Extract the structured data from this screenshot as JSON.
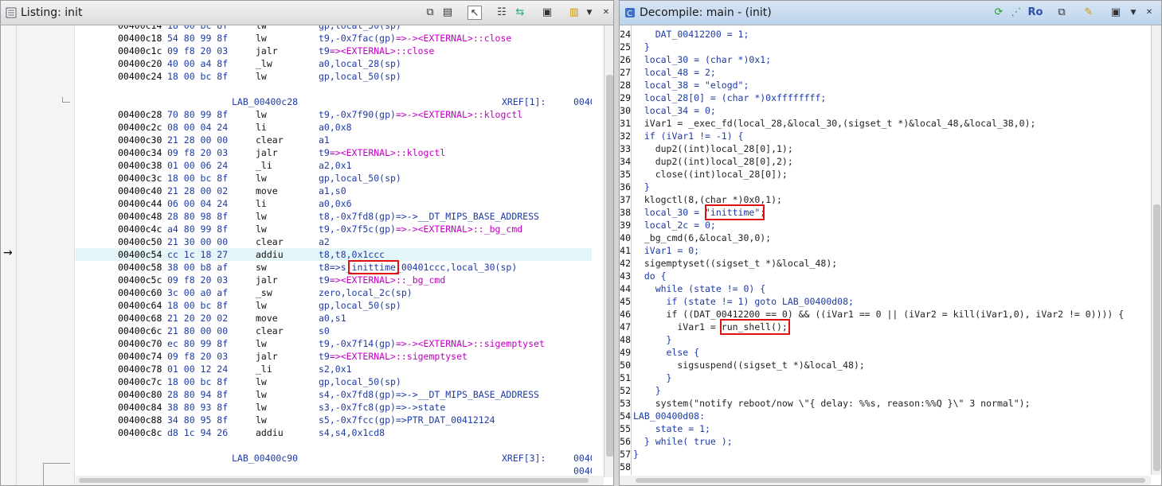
{
  "listing": {
    "title": "Listing:  init",
    "rows": [
      {
        "type": "ins",
        "addr": "00400c14",
        "bytes": "18 00 bc 8f",
        "mnem": "lw",
        "ops": "gp,local_50(sp)"
      },
      {
        "type": "ins",
        "addr": "00400c18",
        "bytes": "54 80 99 8f",
        "mnem": "lw",
        "ops": "t9,-0x7fac(gp)=>-><EXTERNAL>::close"
      },
      {
        "type": "ins",
        "addr": "00400c1c",
        "bytes": "09 f8 20 03",
        "mnem": "jalr",
        "ops": "t9=><EXTERNAL>::close"
      },
      {
        "type": "ins",
        "addr": "00400c20",
        "bytes": "40 00 a4 8f",
        "mnem": "_lw",
        "ops": "a0,local_28(sp)"
      },
      {
        "type": "ins",
        "addr": "00400c24",
        "bytes": "18 00 bc 8f",
        "mnem": "lw",
        "ops": "gp,local_50(sp)"
      },
      {
        "type": "blank"
      },
      {
        "type": "label",
        "label": "LAB_00400c28",
        "xref": "XREF[1]:",
        "xaddr": "0040"
      },
      {
        "type": "ins",
        "addr": "00400c28",
        "bytes": "70 80 99 8f",
        "mnem": "lw",
        "ops": "t9,-0x7f90(gp)=>-><EXTERNAL>::klogctl"
      },
      {
        "type": "ins",
        "addr": "00400c2c",
        "bytes": "08 00 04 24",
        "mnem": "li",
        "ops": "a0,0x8"
      },
      {
        "type": "ins",
        "addr": "00400c30",
        "bytes": "21 28 00 00",
        "mnem": "clear",
        "ops": "a1"
      },
      {
        "type": "ins",
        "addr": "00400c34",
        "bytes": "09 f8 20 03",
        "mnem": "jalr",
        "ops": "t9=><EXTERNAL>::klogctl"
      },
      {
        "type": "ins",
        "addr": "00400c38",
        "bytes": "01 00 06 24",
        "mnem": "_li",
        "ops": "a2,0x1"
      },
      {
        "type": "ins",
        "addr": "00400c3c",
        "bytes": "18 00 bc 8f",
        "mnem": "lw",
        "ops": "gp,local_50(sp)"
      },
      {
        "type": "ins",
        "addr": "00400c40",
        "bytes": "21 28 00 02",
        "mnem": "move",
        "ops": "a1,s0"
      },
      {
        "type": "ins",
        "addr": "00400c44",
        "bytes": "06 00 04 24",
        "mnem": "li",
        "ops": "a0,0x6"
      },
      {
        "type": "ins",
        "addr": "00400c48",
        "bytes": "28 80 98 8f",
        "mnem": "lw",
        "ops": "t8,-0x7fd8(gp)=>->__DT_MIPS_BASE_ADDRESS"
      },
      {
        "type": "ins",
        "addr": "00400c4c",
        "bytes": "a4 80 99 8f",
        "mnem": "lw",
        "ops": "t9,-0x7f5c(gp)=>-><EXTERNAL>::_bg_cmd"
      },
      {
        "type": "ins",
        "addr": "00400c50",
        "bytes": "21 30 00 00",
        "mnem": "clear",
        "ops": "a2"
      },
      {
        "type": "ins",
        "addr": "00400c54",
        "bytes": "cc 1c 18 27",
        "mnem": "addiu",
        "ops": "t8,t8,0x1ccc",
        "hl": true
      },
      {
        "type": "ins",
        "addr": "00400c58",
        "bytes": "38 00 b8 af",
        "mnem": "sw",
        "ops": "t8=>s_inittime_00401ccc,local_30(sp)"
      },
      {
        "type": "ins",
        "addr": "00400c5c",
        "bytes": "09 f8 20 03",
        "mnem": "jalr",
        "ops": "t9=><EXTERNAL>::_bg_cmd"
      },
      {
        "type": "ins",
        "addr": "00400c60",
        "bytes": "3c 00 a0 af",
        "mnem": "_sw",
        "ops": "zero,local_2c(sp)"
      },
      {
        "type": "ins",
        "addr": "00400c64",
        "bytes": "18 00 bc 8f",
        "mnem": "lw",
        "ops": "gp,local_50(sp)"
      },
      {
        "type": "ins",
        "addr": "00400c68",
        "bytes": "21 20 20 02",
        "mnem": "move",
        "ops": "a0,s1"
      },
      {
        "type": "ins",
        "addr": "00400c6c",
        "bytes": "21 80 00 00",
        "mnem": "clear",
        "ops": "s0"
      },
      {
        "type": "ins",
        "addr": "00400c70",
        "bytes": "ec 80 99 8f",
        "mnem": "lw",
        "ops": "t9,-0x7f14(gp)=>-><EXTERNAL>::sigemptyset"
      },
      {
        "type": "ins",
        "addr": "00400c74",
        "bytes": "09 f8 20 03",
        "mnem": "jalr",
        "ops": "t9=><EXTERNAL>::sigemptyset"
      },
      {
        "type": "ins",
        "addr": "00400c78",
        "bytes": "01 00 12 24",
        "mnem": "_li",
        "ops": "s2,0x1"
      },
      {
        "type": "ins",
        "addr": "00400c7c",
        "bytes": "18 00 bc 8f",
        "mnem": "lw",
        "ops": "gp,local_50(sp)"
      },
      {
        "type": "ins",
        "addr": "00400c80",
        "bytes": "28 80 94 8f",
        "mnem": "lw",
        "ops": "s4,-0x7fd8(gp)=>->__DT_MIPS_BASE_ADDRESS"
      },
      {
        "type": "ins",
        "addr": "00400c84",
        "bytes": "38 80 93 8f",
        "mnem": "lw",
        "ops": "s3,-0x7fc8(gp)=>->state"
      },
      {
        "type": "ins",
        "addr": "00400c88",
        "bytes": "34 80 95 8f",
        "mnem": "lw",
        "ops": "s5,-0x7fcc(gp)=>PTR_DAT_00412124"
      },
      {
        "type": "ins",
        "addr": "00400c8c",
        "bytes": "d8 1c 94 26",
        "mnem": "addiu",
        "ops": "s4,s4,0x1cd8"
      },
      {
        "type": "blank"
      },
      {
        "type": "label",
        "label": "LAB_00400c90",
        "xref": "XREF[3]:",
        "xaddr": "0040"
      },
      {
        "type": "extra",
        "xaddr": "0040"
      }
    ]
  },
  "decompile": {
    "title": "Decompile: main -  (init)",
    "ro_label": "Ro",
    "lines": [
      {
        "n": "24",
        "t": "    DAT_00412200 = 1;"
      },
      {
        "n": "25",
        "t": "  }"
      },
      {
        "n": "26",
        "t": "  local_30 = (char *)0x1;"
      },
      {
        "n": "27",
        "t": "  local_48 = 2;"
      },
      {
        "n": "28",
        "t": "  local_38 = \"elogd\";"
      },
      {
        "n": "29",
        "t": "  local_28[0] = (char *)0xffffffff;"
      },
      {
        "n": "30",
        "t": "  local_34 = 0;"
      },
      {
        "n": "31",
        "t": "  iVar1 = _exec_fd(local_28,&local_30,(sigset_t *)&local_48,&local_38,0);"
      },
      {
        "n": "32",
        "t": "  if (iVar1 != -1) {"
      },
      {
        "n": "33",
        "t": "    dup2((int)local_28[0],1);"
      },
      {
        "n": "34",
        "t": "    dup2((int)local_28[0],2);"
      },
      {
        "n": "35",
        "t": "    close((int)local_28[0]);"
      },
      {
        "n": "36",
        "t": "  }"
      },
      {
        "n": "37",
        "t": "  klogctl(8,(char *)0x0,1);"
      },
      {
        "n": "38",
        "t": "  local_30 = \"inittime\";"
      },
      {
        "n": "39",
        "t": "  local_2c = 0;"
      },
      {
        "n": "40",
        "t": "  _bg_cmd(6,&local_30,0);"
      },
      {
        "n": "41",
        "t": "  iVar1 = 0;"
      },
      {
        "n": "42",
        "t": "  sigemptyset((sigset_t *)&local_48);"
      },
      {
        "n": "43",
        "t": "  do {"
      },
      {
        "n": "44",
        "t": "    while (state != 0) {"
      },
      {
        "n": "45",
        "t": "      if (state != 1) goto LAB_00400d08;"
      },
      {
        "n": "46",
        "t": "      if ((DAT_00412200 == 0) && ((iVar1 == 0 || (iVar2 = kill(iVar1,0), iVar2 != 0)))) {"
      },
      {
        "n": "47",
        "t": "        iVar1 = run_shell();"
      },
      {
        "n": "48",
        "t": "      }"
      },
      {
        "n": "49",
        "t": "      else {"
      },
      {
        "n": "50",
        "t": "        sigsuspend((sigset_t *)&local_48);"
      },
      {
        "n": "51",
        "t": "      }"
      },
      {
        "n": "52",
        "t": "    }"
      },
      {
        "n": "53",
        "t": "    system(\"notify reboot/now \\\"{ delay: %%s, reason:%%Q }\\\" 3 normal\");"
      },
      {
        "n": "54",
        "t": "LAB_00400d08:"
      },
      {
        "n": "55",
        "t": "    state = 1;"
      },
      {
        "n": "56",
        "t": "  } while( true );"
      },
      {
        "n": "57",
        "t": "}"
      },
      {
        "n": "58",
        "t": ""
      }
    ]
  },
  "icons": [
    "listing-icon",
    "copy-icon",
    "paste-icon",
    "cursor-icon",
    "field-icon",
    "diff-icon",
    "snapshot-icon",
    "layout-icon",
    "menu-icon",
    "decompile-icon",
    "refresh-icon",
    "graph-icon",
    "export-icon",
    "edit-icon"
  ]
}
